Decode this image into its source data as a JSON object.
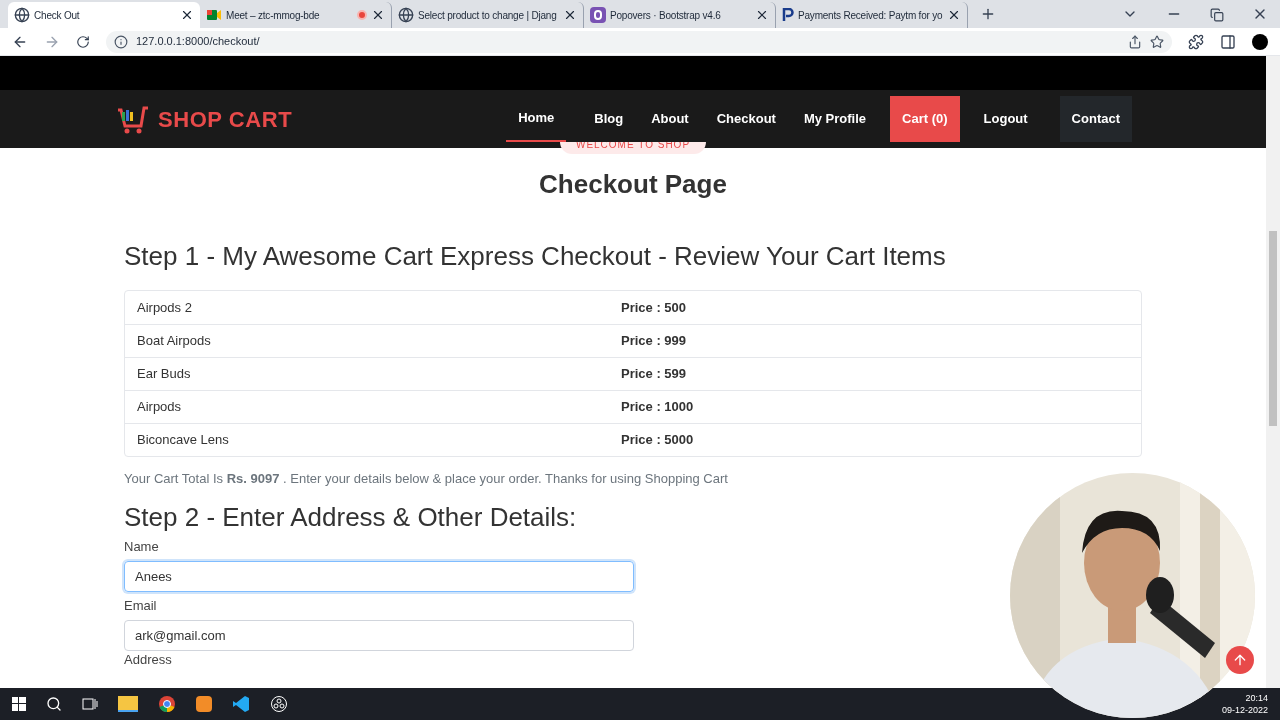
{
  "browser": {
    "tabs": [
      {
        "title": "Check Out",
        "selected": true,
        "kind": "globe"
      },
      {
        "title": "Meet – ztc-mmog-bde",
        "selected": false,
        "kind": "meet",
        "recording": true
      },
      {
        "title": "Select product to change | Djang",
        "selected": false,
        "kind": "globe"
      },
      {
        "title": "Popovers · Bootstrap v4.6",
        "selected": false,
        "kind": "bootstrap"
      },
      {
        "title": "Payments Received: Paytm for yo",
        "selected": false,
        "kind": "paytm"
      }
    ],
    "address": "127.0.0.1:8000/checkout/"
  },
  "navbar": {
    "brand": "SHOP CART",
    "items": [
      {
        "label": "Home",
        "selected": true,
        "kind": "link"
      },
      {
        "label": "Blog",
        "selected": false,
        "kind": "link"
      },
      {
        "label": "About",
        "selected": false,
        "kind": "link"
      },
      {
        "label": "Checkout",
        "selected": false,
        "kind": "link"
      },
      {
        "label": "My Profile",
        "selected": false,
        "kind": "link"
      },
      {
        "label": "Cart (0)",
        "selected": false,
        "kind": "cart"
      },
      {
        "label": "Logout",
        "selected": false,
        "kind": "link"
      },
      {
        "label": "Contact",
        "selected": false,
        "kind": "boxed"
      }
    ]
  },
  "page": {
    "badge": "WELCOME TO SHOP",
    "title": "Checkout Page",
    "step1": "Step 1 - My Awesome Cart Express Checkout - Review Your Cart Items",
    "items": [
      {
        "name": "Airpods 2",
        "price": "Price : 500"
      },
      {
        "name": "Boat Airpods",
        "price": "Price : 999"
      },
      {
        "name": "Ear Buds",
        "price": "Price : 599"
      },
      {
        "name": "Airpods",
        "price": "Price : 1000"
      },
      {
        "name": "Biconcave Lens",
        "price": "Price : 5000"
      }
    ],
    "total": "Your Cart Total Is **Rs. 9097** . Enter your details below & place your order. Thanks for using Shopping Cart",
    "step2": "Step 2 - Enter Address & Other Details:",
    "fields": [
      {
        "label": "Name",
        "value": "Anees",
        "focused": true
      },
      {
        "label": "Email",
        "value": "ark@gmail.com",
        "focused": false
      }
    ],
    "next_label": "Address"
  },
  "taskbar": {
    "time": "20:14",
    "date": "09-12-2022"
  }
}
